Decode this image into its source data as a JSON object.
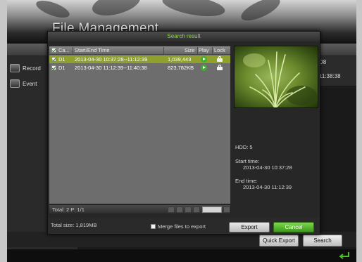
{
  "app": {
    "title": "File Management",
    "side_items": [
      {
        "label": "Record",
        "icon": "record-icon"
      },
      {
        "label": "Event",
        "icon": "event-icon"
      }
    ],
    "right_cells": [
      "D8",
      "11:38:38"
    ],
    "quick_export_label": "Quick Export",
    "search_label": "Search",
    "back_icon": "back-arrow-icon"
  },
  "dialog": {
    "title": "Search result",
    "columns": {
      "camera": "Ca...",
      "start_end": "Start/End Time",
      "size": "Size",
      "play": "Play",
      "lock": "Lock"
    },
    "rows": [
      {
        "checked": true,
        "camera": "D1",
        "time": "2013-04-30 10:37:28--11:12:39",
        "size": "1,039,443",
        "selected": true
      },
      {
        "checked": true,
        "camera": "D1",
        "time": "2013-04-30 11:12:39--11:40:38",
        "size": "823,782KB",
        "selected": false
      }
    ],
    "page_info": "Total: 2  P: 1/1",
    "info": {
      "hdd": "HDD: 5",
      "start_label": "Start time:",
      "start_value": "2013-04-30 10:37:28",
      "end_label": "End time:",
      "end_value": "2013-04-30 11:12:39"
    },
    "total_size": "Total size: 1,819MB",
    "merge_label": "Merge files to export",
    "export_label": "Export",
    "cancel_label": "Cancel"
  },
  "colors": {
    "accent_green": "#3d9a1d",
    "title_green": "#8cdc3c",
    "selected_row": "#8fa02c"
  }
}
